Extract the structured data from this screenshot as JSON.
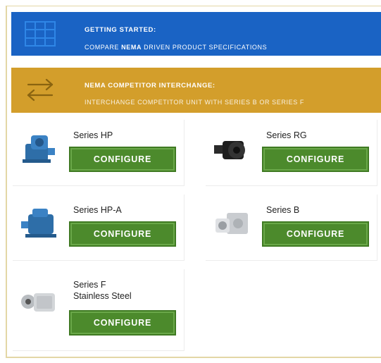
{
  "banners": {
    "getting_started": {
      "title": "GETTING STARTED:",
      "subtitle_pre": "COMPARE ",
      "subtitle_bold": "NEMA",
      "subtitle_post": " DRIVEN PRODUCT SPECIFICATIONS",
      "color": "#1a63c4",
      "icon": "grid-table-icon"
    },
    "interchange": {
      "title": "NEMA COMPETITOR INTERCHANGE:",
      "subtitle": "INTERCHANGE COMPETITOR UNIT WITH SERIES B OR SERIES F",
      "color": "#d39e2b",
      "icon": "swap-arrows-icon"
    }
  },
  "products": [
    {
      "name": "Series HP",
      "button": "CONFIGURE",
      "image": "blue-gearbox-image"
    },
    {
      "name": "Series RG",
      "button": "CONFIGURE",
      "image": "black-gearbox-image"
    },
    {
      "name": "Series HP-A",
      "button": "CONFIGURE",
      "image": "blue-gearbox-image"
    },
    {
      "name": "Series B",
      "button": "CONFIGURE",
      "image": "aluminum-gearbox-image"
    },
    {
      "name_line1": "Series F",
      "name_line2": "Stainless Steel",
      "button": "CONFIGURE",
      "image": "stainless-gearbox-image"
    }
  ],
  "colors": {
    "button_green": "#4c8a2c",
    "banner_blue": "#1a63c4",
    "banner_gold": "#d39e2b"
  }
}
